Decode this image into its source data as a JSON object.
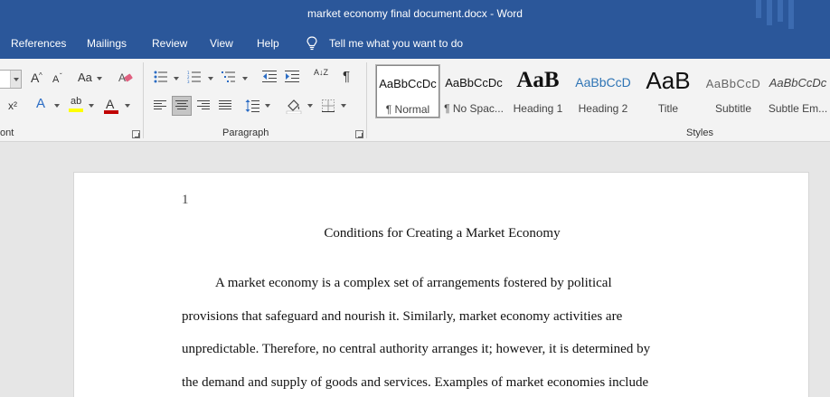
{
  "window": {
    "title": "market economy final document.docx  -  Word"
  },
  "menu": {
    "tabs": [
      "References",
      "Mailings",
      "Review",
      "View",
      "Help"
    ],
    "tell_me": "Tell me what you want to do"
  },
  "ribbon": {
    "font_group_label": "ont",
    "paragraph_group_label": "Paragraph",
    "styles_group_label": "Styles",
    "font": {
      "grow": "A",
      "shrink": "A",
      "change_case": "Aa",
      "superscript": "x²",
      "text_effects": "A",
      "highlight": "ab",
      "font_color": "A",
      "highlight_color": "#ffff00",
      "font_color_bar": "#c00000"
    },
    "paragraph": {
      "sort": "A↓Z",
      "pilcrow": "¶",
      "line_spacing_icon": "line-spacing-icon"
    },
    "styles": [
      {
        "preview": "AaBbCcDc",
        "name": "¶ Normal"
      },
      {
        "preview": "AaBbCcDc",
        "name": "¶ No Spac..."
      },
      {
        "preview": "AaB",
        "name": "Heading 1"
      },
      {
        "preview": "AaBbCcD",
        "name": "Heading 2"
      },
      {
        "preview": "AaB",
        "name": "Title"
      },
      {
        "preview": "AaBbCcD",
        "name": "Subtitle"
      },
      {
        "preview": "AaBbCcDc",
        "name": "Subtle Em..."
      }
    ]
  },
  "document": {
    "page_number": "1",
    "title": "Conditions for Creating a Market Economy",
    "paragraph_lines": [
      "A market economy is a complex set of arrangements fostered by political",
      "provisions that safeguard and nourish it. Similarly, market economy activities are",
      "unpredictable. Therefore, no central authority arranges it; however, it is determined by",
      "the demand and supply of goods and services. Examples of market economies include"
    ]
  }
}
